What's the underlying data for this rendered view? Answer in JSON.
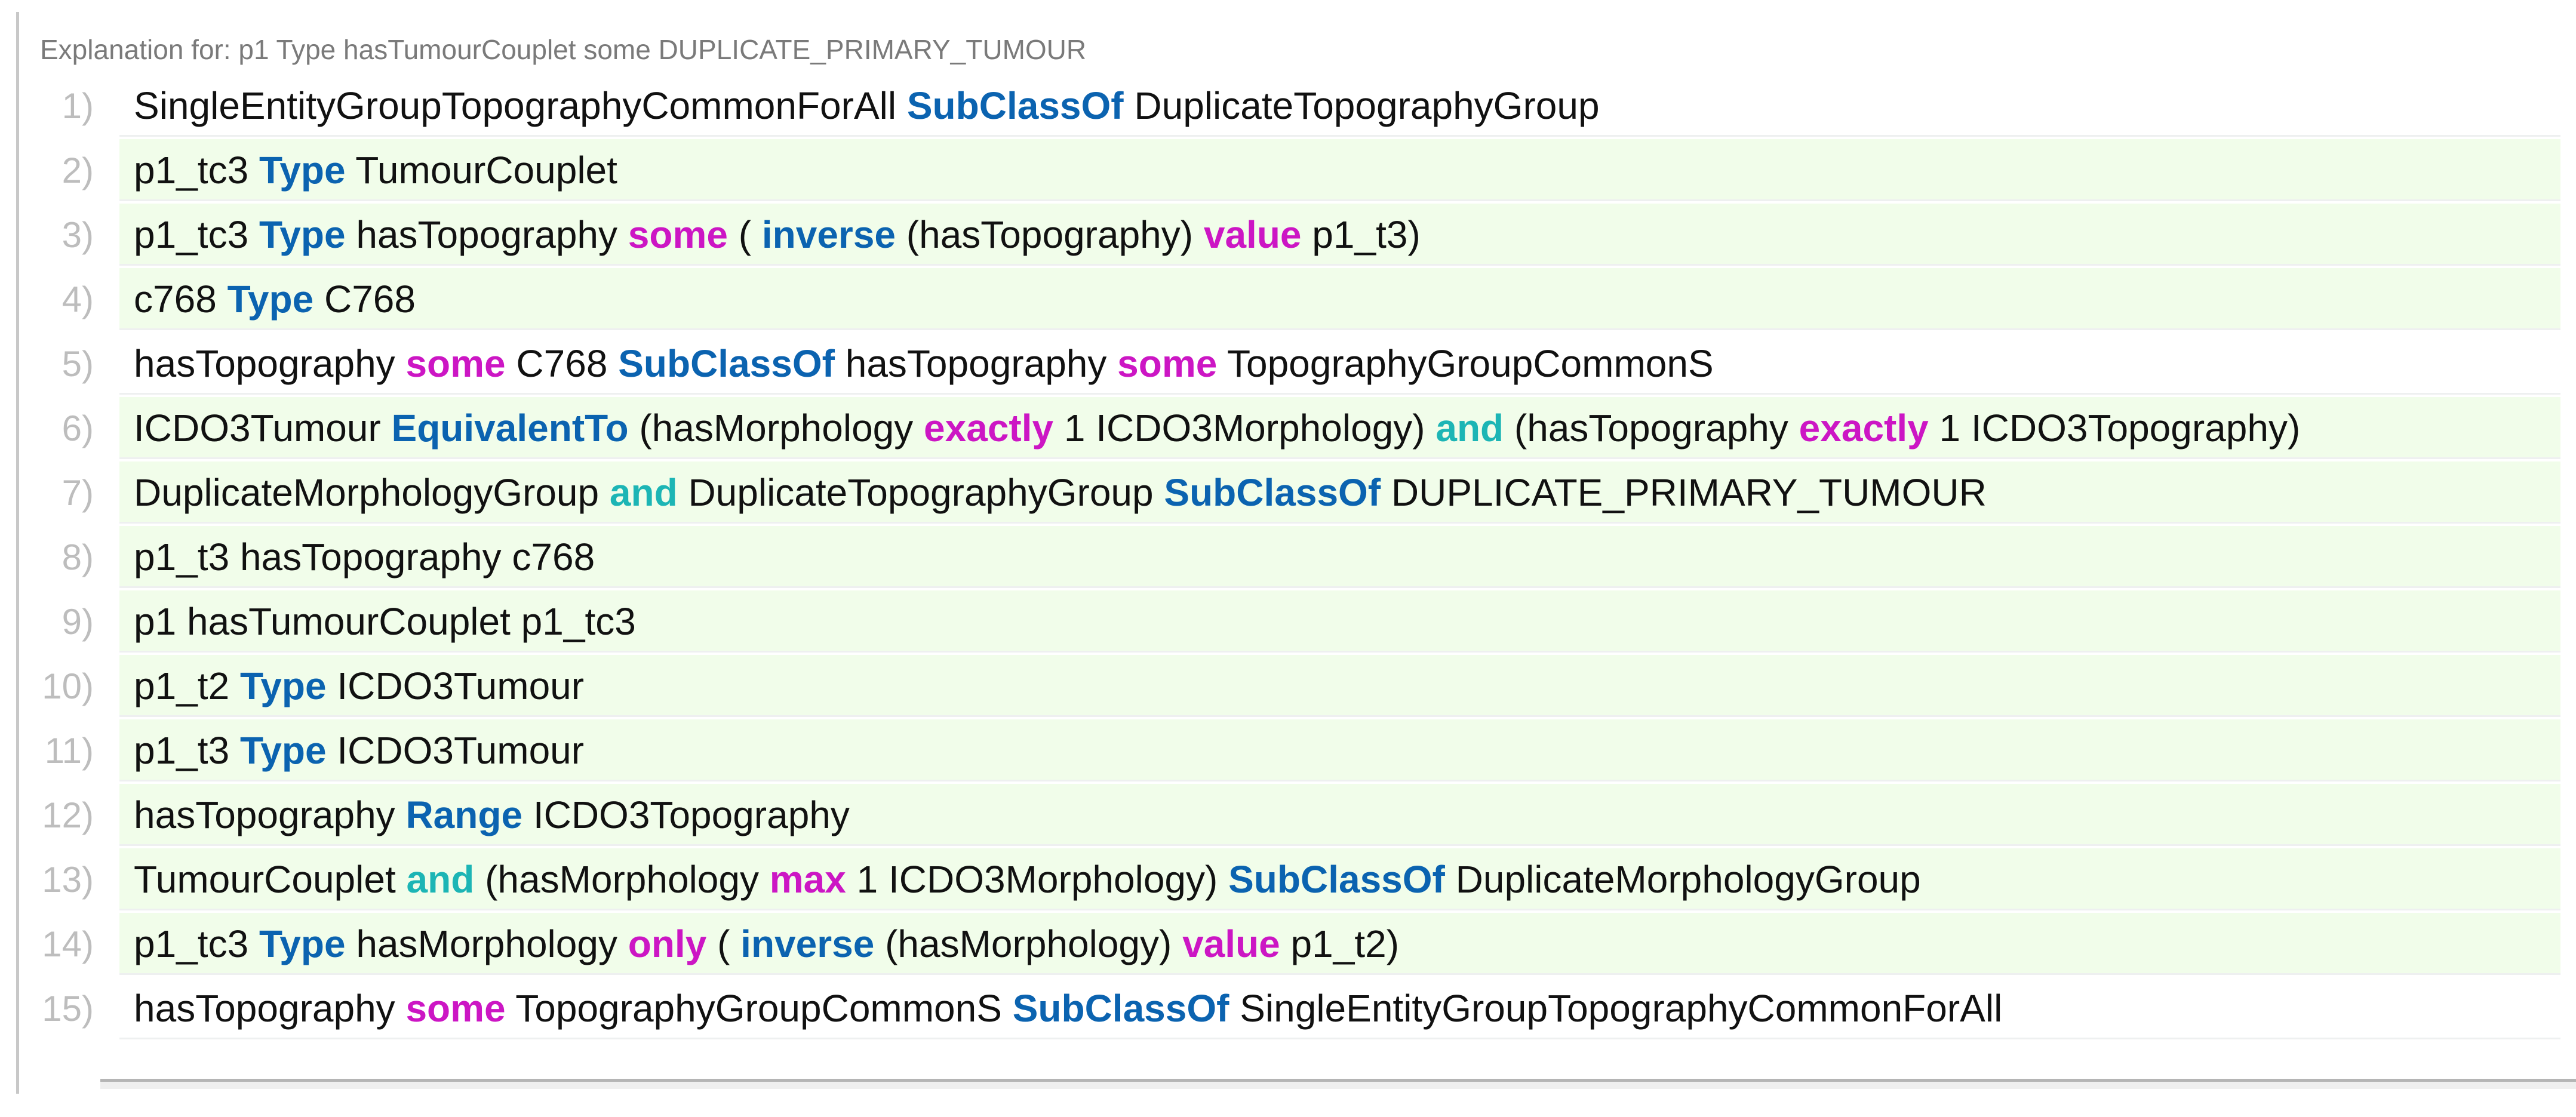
{
  "header": "Explanation for: p1 Type hasTumourCouplet some DUPLICATE_PRIMARY_TUMOUR",
  "colors": {
    "keyword": "#0b63b0",
    "quantifier": "#cc16c4",
    "operator": "#1cb5b5",
    "row_highlight": "#f1fdea"
  },
  "lines": [
    {
      "num": "1)",
      "green": false,
      "segs": [
        [
          "SingleEntityGroupTopographyCommonForAll ",
          ""
        ],
        [
          "SubClassOf",
          "kw"
        ],
        [
          " DuplicateTopographyGroup",
          ""
        ]
      ]
    },
    {
      "num": "2)",
      "green": true,
      "segs": [
        [
          "p1_tc3 ",
          ""
        ],
        [
          "Type",
          "kw"
        ],
        [
          " TumourCouplet",
          ""
        ]
      ]
    },
    {
      "num": "3)",
      "green": true,
      "segs": [
        [
          "p1_tc3 ",
          ""
        ],
        [
          "Type",
          "kw"
        ],
        [
          " hasTopography ",
          ""
        ],
        [
          "some",
          "q"
        ],
        [
          " ( ",
          ""
        ],
        [
          "inverse",
          "kw"
        ],
        [
          " (hasTopography) ",
          ""
        ],
        [
          "value",
          "q"
        ],
        [
          " p1_t3)",
          ""
        ]
      ]
    },
    {
      "num": "4)",
      "green": true,
      "segs": [
        [
          "c768 ",
          ""
        ],
        [
          "Type",
          "kw"
        ],
        [
          " C768",
          ""
        ]
      ]
    },
    {
      "num": "5)",
      "green": false,
      "segs": [
        [
          "hasTopography ",
          ""
        ],
        [
          "some",
          "q"
        ],
        [
          " C768 ",
          ""
        ],
        [
          "SubClassOf",
          "kw"
        ],
        [
          " hasTopography ",
          ""
        ],
        [
          "some",
          "q"
        ],
        [
          " TopographyGroupCommonS",
          ""
        ]
      ]
    },
    {
      "num": "6)",
      "green": true,
      "segs": [
        [
          "ICDO3Tumour ",
          ""
        ],
        [
          "EquivalentTo",
          "kw"
        ],
        [
          " (hasMorphology ",
          ""
        ],
        [
          "exactly",
          "q"
        ],
        [
          " 1 ICDO3Morphology) ",
          ""
        ],
        [
          "and",
          "op"
        ],
        [
          " (hasTopography ",
          ""
        ],
        [
          "exactly",
          "q"
        ],
        [
          " 1 ICDO3Topography)",
          ""
        ]
      ]
    },
    {
      "num": "7)",
      "green": true,
      "segs": [
        [
          "DuplicateMorphologyGroup ",
          ""
        ],
        [
          "and",
          "op"
        ],
        [
          " DuplicateTopographyGroup ",
          ""
        ],
        [
          "SubClassOf",
          "kw"
        ],
        [
          " DUPLICATE_PRIMARY_TUMOUR",
          ""
        ]
      ]
    },
    {
      "num": "8)",
      "green": true,
      "segs": [
        [
          "p1_t3 hasTopography c768",
          ""
        ]
      ]
    },
    {
      "num": "9)",
      "green": true,
      "segs": [
        [
          "p1 hasTumourCouplet p1_tc3",
          ""
        ]
      ]
    },
    {
      "num": "10)",
      "green": true,
      "segs": [
        [
          "p1_t2 ",
          ""
        ],
        [
          "Type",
          "kw"
        ],
        [
          " ICDO3Tumour",
          ""
        ]
      ]
    },
    {
      "num": "11)",
      "green": true,
      "segs": [
        [
          "p1_t3 ",
          ""
        ],
        [
          "Type",
          "kw"
        ],
        [
          " ICDO3Tumour",
          ""
        ]
      ]
    },
    {
      "num": "12)",
      "green": true,
      "segs": [
        [
          "hasTopography ",
          ""
        ],
        [
          "Range",
          "kw"
        ],
        [
          " ICDO3Topography",
          ""
        ]
      ]
    },
    {
      "num": "13)",
      "green": true,
      "segs": [
        [
          "TumourCouplet ",
          ""
        ],
        [
          "and",
          "op"
        ],
        [
          " (hasMorphology ",
          ""
        ],
        [
          "max",
          "q"
        ],
        [
          " 1 ICDO3Morphology) ",
          ""
        ],
        [
          "SubClassOf",
          "kw"
        ],
        [
          " DuplicateMorphologyGroup",
          ""
        ]
      ]
    },
    {
      "num": "14)",
      "green": true,
      "segs": [
        [
          "p1_tc3 ",
          ""
        ],
        [
          "Type",
          "kw"
        ],
        [
          " hasMorphology ",
          ""
        ],
        [
          "only",
          "q"
        ],
        [
          " ( ",
          ""
        ],
        [
          "inverse",
          "kw"
        ],
        [
          " (hasMorphology) ",
          ""
        ],
        [
          "value",
          "q"
        ],
        [
          " p1_t2)",
          ""
        ]
      ]
    },
    {
      "num": "15)",
      "green": false,
      "segs": [
        [
          "hasTopography ",
          ""
        ],
        [
          "some",
          "q"
        ],
        [
          " TopographyGroupCommonS ",
          ""
        ],
        [
          "SubClassOf",
          "kw"
        ],
        [
          " SingleEntityGroupTopographyCommonForAll",
          ""
        ]
      ]
    }
  ]
}
